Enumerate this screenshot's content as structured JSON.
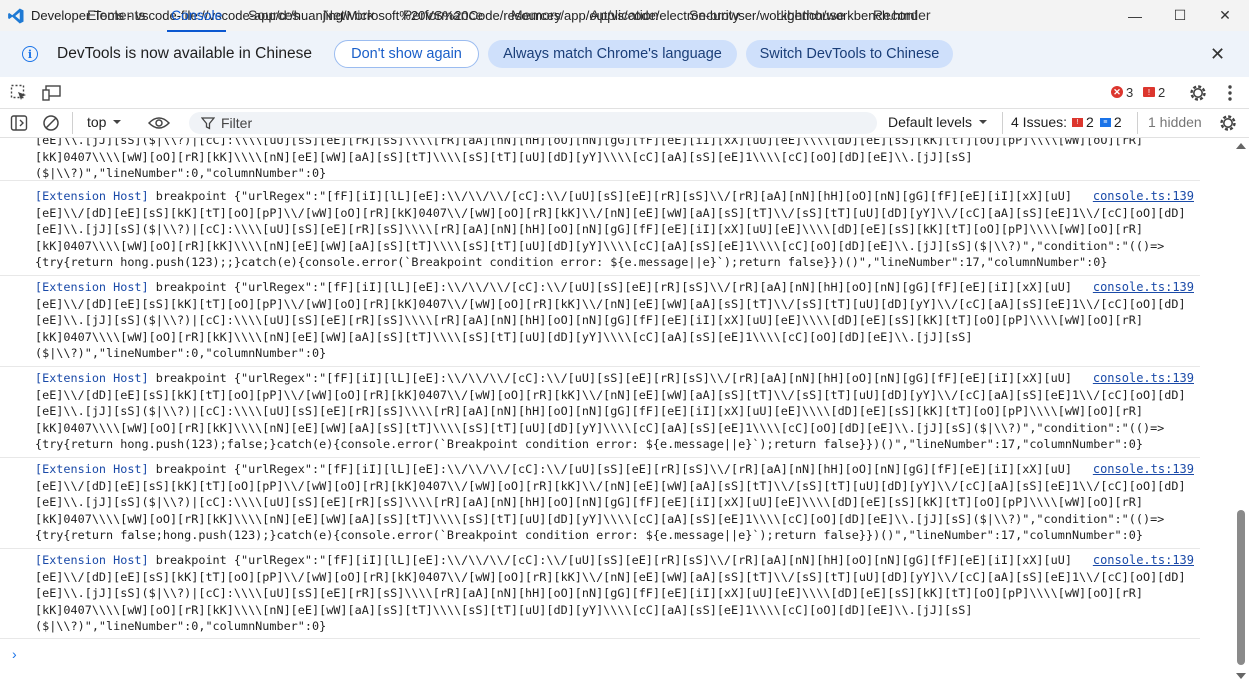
{
  "window": {
    "title": "Developer Tools - vscode-file://vscode-app/d:/huanjing/Microsoft%20VS%20Code/resources/app/out/vs/code/electron-browser/workbench/workbench.html",
    "minimize": "—",
    "maximize": "☐",
    "close": "✕"
  },
  "notice": {
    "message": "DevTools is now available in Chinese",
    "dont_show": "Don't show again",
    "match_language": "Always match Chrome's language",
    "switch": "Switch DevTools to Chinese",
    "close": "✕"
  },
  "tabs": [
    "Elements",
    "Console",
    "Sources",
    "Network",
    "Performance",
    "Memory",
    "Application",
    "Security",
    "Lighthouse",
    "Recorder"
  ],
  "active_tab": "Console",
  "badges": {
    "errors": "3",
    "warnings": "2"
  },
  "toolbar": {
    "context": "top",
    "filter_placeholder": "Filter",
    "levels": "Default levels",
    "issues_label": "4 Issues:",
    "issues_errors": "2",
    "issues_info": "2",
    "hidden": "1 hidden"
  },
  "colors": {
    "accent": "#0b57d0",
    "error": "#dc362e",
    "link": "#1a4aa8"
  },
  "console": {
    "entries": [
      {
        "source": "",
        "link": "",
        "body": "[eE]\\\\.[jJ][sS]($|\\\\?)|[cC]:\\\\\\\\[uU][sS][eE][rR][sS]\\\\\\\\[rR][aA][nN][hH][oO][nN][gG][fF][eE][iI][xX][uU][eE]\\\\\\\\[dD][eE][sS][kK][tT][oO][pP]\\\\\\\\[wW][oO][rR]\n[kK]0407\\\\\\\\[wW][oO][rR][kK]\\\\\\\\[nN][eE][wW][aA][sS][tT]\\\\\\\\[sS][tT][uU][dD][yY]\\\\\\\\[cC][aA][sS][eE]1\\\\\\\\[cC][oO][dD][eE]\\\\.[jJ][sS]\n($|\\\\?)\",\"lineNumber\":0,\"columnNumber\":0}"
      },
      {
        "source": "[Extension Host]",
        "link": "console.ts:139",
        "body": " breakpoint {\"urlRegex\":\"[fF][iI][lL][eE]:\\\\/\\\\/\\\\/[cC]:\\\\/[uU][sS][eE][rR][sS]\\\\/[rR][aA][nN][hH][oO][nN][gG][fF][eE][iI][xX][uU]\n[eE]\\\\/[dD][eE][sS][kK][tT][oO][pP]\\\\/[wW][oO][rR][kK]0407\\\\/[wW][oO][rR][kK]\\\\/[nN][eE][wW][aA][sS][tT]\\\\/[sS][tT][uU][dD][yY]\\\\/[cC][aA][sS][eE]1\\\\/[cC][oO][dD]\n[eE]\\\\.[jJ][sS]($|\\\\?)|[cC]:\\\\\\\\[uU][sS][eE][rR][sS]\\\\\\\\[rR][aA][nN][hH][oO][nN][gG][fF][eE][iI][xX][uU][eE]\\\\\\\\[dD][eE][sS][kK][tT][oO][pP]\\\\\\\\[wW][oO][rR]\n[kK]0407\\\\\\\\[wW][oO][rR][kK]\\\\\\\\[nN][eE][wW][aA][sS][tT]\\\\\\\\[sS][tT][uU][dD][yY]\\\\\\\\[cC][aA][sS][eE]1\\\\\\\\[cC][oO][dD][eE]\\\\.[jJ][sS]($|\\\\?)\",\"condition\":\"(()=>\n{try{return hong.push(123);;}catch(e){console.error(`Breakpoint condition error: ${e.message||e}`);return false}})()\",\"lineNumber\":17,\"columnNumber\":0}"
      },
      {
        "source": "[Extension Host]",
        "link": "console.ts:139",
        "body": " breakpoint {\"urlRegex\":\"[fF][iI][lL][eE]:\\\\/\\\\/\\\\/[cC]:\\\\/[uU][sS][eE][rR][sS]\\\\/[rR][aA][nN][hH][oO][nN][gG][fF][eE][iI][xX][uU]\n[eE]\\\\/[dD][eE][sS][kK][tT][oO][pP]\\\\/[wW][oO][rR][kK]0407\\\\/[wW][oO][rR][kK]\\\\/[nN][eE][wW][aA][sS][tT]\\\\/[sS][tT][uU][dD][yY]\\\\/[cC][aA][sS][eE]1\\\\/[cC][oO][dD]\n[eE]\\\\.[jJ][sS]($|\\\\?)|[cC]:\\\\\\\\[uU][sS][eE][rR][sS]\\\\\\\\[rR][aA][nN][hH][oO][nN][gG][fF][eE][iI][xX][uU][eE]\\\\\\\\[dD][eE][sS][kK][tT][oO][pP]\\\\\\\\[wW][oO][rR]\n[kK]0407\\\\\\\\[wW][oO][rR][kK]\\\\\\\\[nN][eE][wW][aA][sS][tT]\\\\\\\\[sS][tT][uU][dD][yY]\\\\\\\\[cC][aA][sS][eE]1\\\\\\\\[cC][oO][dD][eE]\\\\.[jJ][sS]\n($|\\\\?)\",\"lineNumber\":0,\"columnNumber\":0}"
      },
      {
        "source": "[Extension Host]",
        "link": "console.ts:139",
        "body": " breakpoint {\"urlRegex\":\"[fF][iI][lL][eE]:\\\\/\\\\/\\\\/[cC]:\\\\/[uU][sS][eE][rR][sS]\\\\/[rR][aA][nN][hH][oO][nN][gG][fF][eE][iI][xX][uU]\n[eE]\\\\/[dD][eE][sS][kK][tT][oO][pP]\\\\/[wW][oO][rR][kK]0407\\\\/[wW][oO][rR][kK]\\\\/[nN][eE][wW][aA][sS][tT]\\\\/[sS][tT][uU][dD][yY]\\\\/[cC][aA][sS][eE]1\\\\/[cC][oO][dD]\n[eE]\\\\.[jJ][sS]($|\\\\?)|[cC]:\\\\\\\\[uU][sS][eE][rR][sS]\\\\\\\\[rR][aA][nN][hH][oO][nN][gG][fF][eE][iI][xX][uU][eE]\\\\\\\\[dD][eE][sS][kK][tT][oO][pP]\\\\\\\\[wW][oO][rR]\n[kK]0407\\\\\\\\[wW][oO][rR][kK]\\\\\\\\[nN][eE][wW][aA][sS][tT]\\\\\\\\[sS][tT][uU][dD][yY]\\\\\\\\[cC][aA][sS][eE]1\\\\\\\\[cC][oO][dD][eE]\\\\.[jJ][sS]($|\\\\?)\",\"condition\":\"(()=>\n{try{return hong.push(123);false;}catch(e){console.error(`Breakpoint condition error: ${e.message||e}`);return false}})()\",\"lineNumber\":17,\"columnNumber\":0}"
      },
      {
        "source": "[Extension Host]",
        "link": "console.ts:139",
        "body": " breakpoint {\"urlRegex\":\"[fF][iI][lL][eE]:\\\\/\\\\/\\\\/[cC]:\\\\/[uU][sS][eE][rR][sS]\\\\/[rR][aA][nN][hH][oO][nN][gG][fF][eE][iI][xX][uU]\n[eE]\\\\/[dD][eE][sS][kK][tT][oO][pP]\\\\/[wW][oO][rR][kK]0407\\\\/[wW][oO][rR][kK]\\\\/[nN][eE][wW][aA][sS][tT]\\\\/[sS][tT][uU][dD][yY]\\\\/[cC][aA][sS][eE]1\\\\/[cC][oO][dD]\n[eE]\\\\.[jJ][sS]($|\\\\?)|[cC]:\\\\\\\\[uU][sS][eE][rR][sS]\\\\\\\\[rR][aA][nN][hH][oO][nN][gG][fF][eE][iI][xX][uU][eE]\\\\\\\\[dD][eE][sS][kK][tT][oO][pP]\\\\\\\\[wW][oO][rR]\n[kK]0407\\\\\\\\[wW][oO][rR][kK]\\\\\\\\[nN][eE][wW][aA][sS][tT]\\\\\\\\[sS][tT][uU][dD][yY]\\\\\\\\[cC][aA][sS][eE]1\\\\\\\\[cC][oO][dD][eE]\\\\.[jJ][sS]($|\\\\?)\",\"condition\":\"(()=>\n{try{return false;hong.push(123);}catch(e){console.error(`Breakpoint condition error: ${e.message||e}`);return false}})()\",\"lineNumber\":17,\"columnNumber\":0}"
      },
      {
        "source": "[Extension Host]",
        "link": "console.ts:139",
        "body": " breakpoint {\"urlRegex\":\"[fF][iI][lL][eE]:\\\\/\\\\/\\\\/[cC]:\\\\/[uU][sS][eE][rR][sS]\\\\/[rR][aA][nN][hH][oO][nN][gG][fF][eE][iI][xX][uU]\n[eE]\\\\/[dD][eE][sS][kK][tT][oO][pP]\\\\/[wW][oO][rR][kK]0407\\\\/[wW][oO][rR][kK]\\\\/[nN][eE][wW][aA][sS][tT]\\\\/[sS][tT][uU][dD][yY]\\\\/[cC][aA][sS][eE]1\\\\/[cC][oO][dD]\n[eE]\\\\.[jJ][sS]($|\\\\?)|[cC]:\\\\\\\\[uU][sS][eE][rR][sS]\\\\\\\\[rR][aA][nN][hH][oO][nN][gG][fF][eE][iI][xX][uU][eE]\\\\\\\\[dD][eE][sS][kK][tT][oO][pP]\\\\\\\\[wW][oO][rR]\n[kK]0407\\\\\\\\[wW][oO][rR][kK]\\\\\\\\[nN][eE][wW][aA][sS][tT]\\\\\\\\[sS][tT][uU][dD][yY]\\\\\\\\[cC][aA][sS][eE]1\\\\\\\\[cC][oO][dD][eE]\\\\.[jJ][sS]\n($|\\\\?)\",\"lineNumber\":0,\"columnNumber\":0}"
      }
    ],
    "prompt": "›"
  }
}
